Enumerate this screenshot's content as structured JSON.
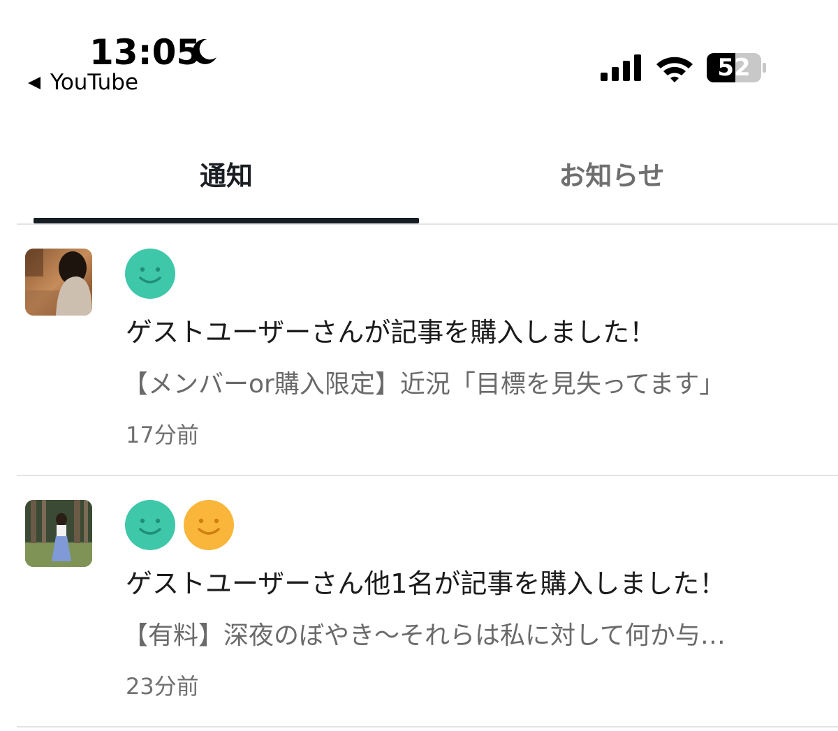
{
  "status_bar": {
    "time": "13:05",
    "back_app": "YouTube",
    "battery": "52",
    "battery_level_percent": 52
  },
  "tabs": [
    {
      "label": "通知",
      "selected": true
    },
    {
      "label": "お知らせ",
      "selected": false
    }
  ],
  "notifications": [
    {
      "message": "ゲストユーザーさんが記事を購入しました！",
      "article": "【メンバーor購入限定】近況「目標を見失ってます」",
      "time": "17分前",
      "avatars": [
        "smile-face-icon-green"
      ]
    },
    {
      "message": "ゲストユーザーさん他1名が記事を購入しました！",
      "article": "【有料】深夜のぼやき〜それらは私に対して何か与…",
      "time": "23分前",
      "avatars": [
        "smile-face-icon-green",
        "smile-face-icon-orange"
      ]
    }
  ],
  "colors": {
    "face_green": "#3ec8a9",
    "face_orange": "#f9b63a",
    "tab_underline": "#161d24",
    "divider": "#e3e3e3"
  }
}
